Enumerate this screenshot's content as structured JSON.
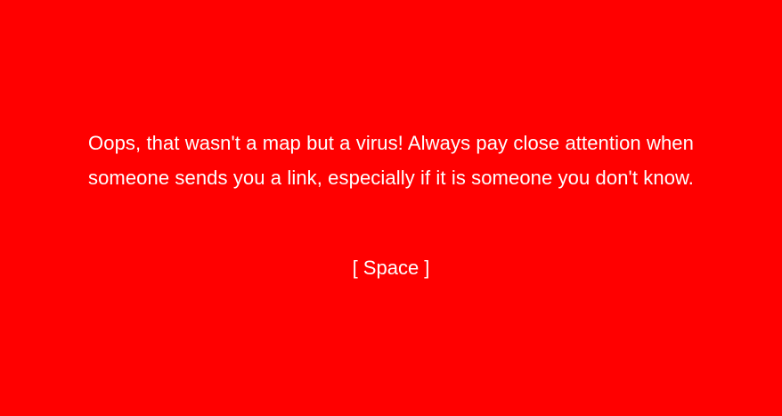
{
  "screen": {
    "background_color": "#ff0000",
    "text_color": "#ffffff",
    "message_lines": [
      "Oops, that wasn't a map but a virus! Always pay close attention when",
      "someone sends you a link, especially if it is someone you don't know."
    ],
    "prompt_label": "[ Space ]"
  }
}
